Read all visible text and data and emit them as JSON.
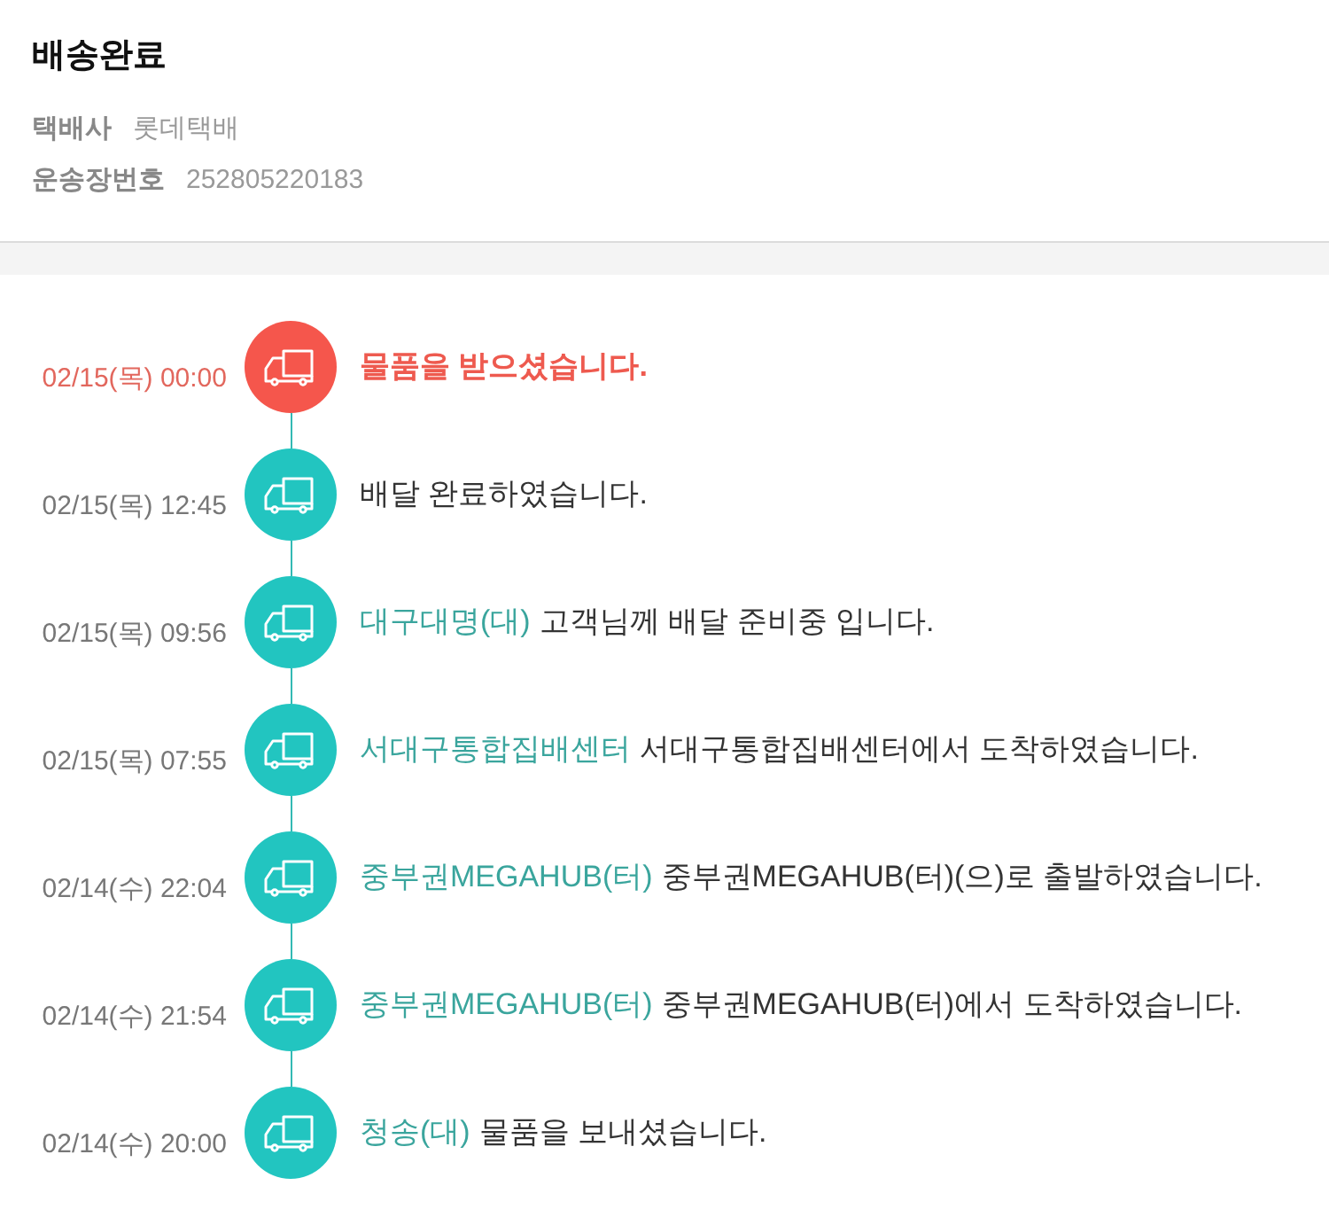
{
  "header": {
    "title": "배송완료",
    "details": [
      {
        "label": "택배사",
        "value": "롯데택배"
      },
      {
        "label": "운송장번호",
        "value": "252805220183"
      }
    ]
  },
  "timeline": [
    {
      "time": "02/15(목) 00:00",
      "message": "물품을 받으셨습니다.",
      "current": true
    },
    {
      "time": "02/15(목) 12:45",
      "message": "배달 완료하였습니다.",
      "current": false
    },
    {
      "time": "02/15(목) 09:56",
      "place": "대구대명(대)",
      "message": "고객님께 배달 준비중 입니다.",
      "current": false
    },
    {
      "time": "02/15(목) 07:55",
      "place": "서대구통합집배센터",
      "message": "서대구통합집배센터에서 도착하였습니다.",
      "current": false
    },
    {
      "time": "02/14(수) 22:04",
      "place": "중부권MEGAHUB(터)",
      "message": "중부권MEGAHUB(터)(으)로 출발하였습니다.",
      "current": false
    },
    {
      "time": "02/14(수) 21:54",
      "place": "중부권MEGAHUB(터)",
      "message": "중부권MEGAHUB(터)에서 도착하였습니다.",
      "current": false
    },
    {
      "time": "02/14(수) 20:00",
      "place": "청송(대)",
      "message": "물품을 보내셨습니다.",
      "current": false
    }
  ]
}
